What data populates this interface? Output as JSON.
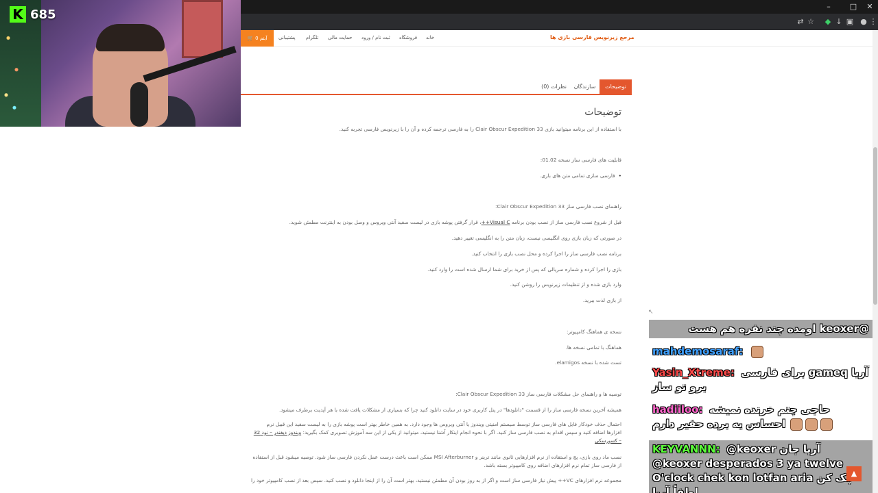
{
  "stream": {
    "viewer_count": "685"
  },
  "browser": {
    "minimize_glyph": "–",
    "maximize_glyph": "□",
    "close_glyph": "✕"
  },
  "site": {
    "brand": "مرجع زیرنویس فارسی بازی ها",
    "cart_label": "0 آیتم",
    "nav": [
      "خانه",
      "فروشگاه",
      "ثبت نام / ورود",
      "حمایت مالی",
      "تلگرام",
      "پشتیبانی"
    ]
  },
  "tabs": [
    {
      "label": "توضیحات",
      "active": true
    },
    {
      "label": "سازندگان",
      "active": false
    },
    {
      "label": "نظرات (0)",
      "active": false
    }
  ],
  "article": {
    "heading": "توضیحات",
    "intro": "با استفاده از این برنامه میتوانید بازی Clair Obscur Expedition 33 را به فارسی ترجمه کرده و آن را با زیرنویس فارسی تجربه کنید.",
    "features_title": "قابلیت های فارسی ساز نسخه 01.02:",
    "feature_1": "فارسی سازی تمامی متن های بازی.",
    "install_title": "راهنمای نصب فارسی ساز Clair Obscur Expedition 33:",
    "step_1a": "قبل از شروع نصب فارسی ساز از نصب بودن برنامه ",
    "step_1_link": "Visual C++",
    "step_1b": "، قرار گرفتن پوشه بازی در لیست سفید آنتی ویروس و وصل بودن به اینترنت مطمئن شوید.",
    "step_2": "در صورتی که زبان بازی روی انگلیسی نیست، زبان متن را به انگلیسی تغییر دهید.",
    "step_3": "برنامه نصب فارسی ساز را اجرا کرده و محل نصب بازی را انتخاب کنید.",
    "step_4": "بازی را اجرا کرده و شماره سریالی که پس از خرید برای شما ارسال شده است را وارد کنید.",
    "step_5": "وارد بازی شده و از تنظیمات زیرنویس را روشن کنید.",
    "step_6": "از بازی لذت ببرید.",
    "compat_title": "نسخه ی هماهنگ کامپیوتر:",
    "compat_1": "هماهنگ با تمامی نسخه ها.",
    "compat_2": "تست شده با نسخه elamigos.",
    "tips_title": "توصیه ها و راهنمای حل مشکلات فارسی ساز Clair Obscur Expedition 33:",
    "tip_1": "همیشه آخرین نسخه فارسی ساز را از قسمت \"دانلودها\" در پنل کاربری خود در سایت دانلود کنید چرا که بسیاری از مشکلات یافت شده با هر آپدیت برطرف میشود.",
    "tip_2a": "احتمال حذف خودکار فایل های فارسی ساز توسط سیستم امنیتی ویندوز یا آنتی ویروس ها وجود دارد. به همین خاطر بهتر است پوشه بازی را به لیست سفید این قبیل نرم افزارها اضافه کنید و سپس اقدام به نصب فارسی ساز کنید. اگر با نحوه انجام اینکار آشنا نیستید، میتوانید از یکی از این سه آموزش تصویری کمک بگیرید: ",
    "tip_2_links": "ویندوز دیفندر – نود 32 – کسپرسکی",
    "tip_3": "نصب ماد روی بازی، پچ و استفاده از نرم افزارهایی ثانوی مانند ترینر و MSI Afterburner ممکن است باعث درست عمل نکردن فارسی ساز شود. توصیه میشود قبل از استفاده از فارسی ساز تمام نرم افزارهای اضافه روی کامپیوتر بسته باشد.",
    "tip_4": "مجموعه نرم افزارهای VC++ پیش نیاز فارسی ساز است و اگر از به روز بودن آن مطمئن نیستید، بهتر است آن را از اینجا دانلود و نصب کنید. سپس بعد از نصب کامپیوتر خود را"
  },
  "chat": [
    {
      "user": "",
      "text": "@keoxer اومده چند نفره هم هست",
      "user_color": "#ffffff",
      "highlight": true,
      "emotes": 0
    },
    {
      "user": "mahdemosaraf:",
      "text": "",
      "user_color": "#3fa0ff",
      "highlight": false,
      "emotes": 1
    },
    {
      "user": "Yasin_Xtreme:",
      "text": "برای فارسی gameq آریا برو تو ساز",
      "user_color": "#ff4a4a",
      "highlight": false,
      "emotes": 0
    },
    {
      "user": "hadiiloo:",
      "text": "حاجی چتم خرنده نمیشه احساس یه برده حقیر دارم",
      "user_color": "#ff66cc",
      "highlight": false,
      "emotes": 3
    },
    {
      "user": "KEYVANNN:",
      "text": "@keoxer آریا جان @keoxer desperados 3 ya twelve O'clock chek kon lotfan aria چک کن لطفاً آریا",
      "user_color": "#5bff3a",
      "highlight": true,
      "emotes": 0
    }
  ],
  "colors": {
    "accent": "#e4572e",
    "brand": "#e05a10",
    "kick_green": "#53fc18"
  }
}
